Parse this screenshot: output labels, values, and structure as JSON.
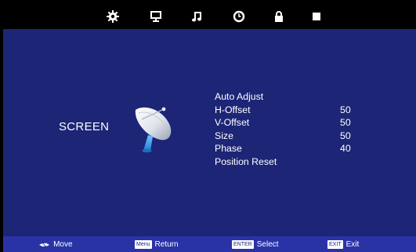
{
  "tabs": [
    {
      "icon": "gear-icon",
      "label": "Picture"
    },
    {
      "icon": "monitor-icon",
      "label": "Screen"
    },
    {
      "icon": "music-icon",
      "label": "Sound"
    },
    {
      "icon": "clock-icon",
      "label": "Time"
    },
    {
      "icon": "lock-icon",
      "label": "Lock"
    },
    {
      "icon": "square-icon",
      "label": "Setup"
    }
  ],
  "category": "SCREEN",
  "menu": {
    "items": [
      {
        "label": "Auto Adjust",
        "value": ""
      },
      {
        "label": "H-Offset",
        "value": "50"
      },
      {
        "label": "V-Offset",
        "value": "50"
      },
      {
        "label": "Size",
        "value": "50"
      },
      {
        "label": "Phase",
        "value": "40"
      },
      {
        "label": "Position Reset",
        "value": ""
      }
    ]
  },
  "footer": {
    "move": {
      "icon": "dpad-icon",
      "label": "Move"
    },
    "return": {
      "key": "Menu",
      "label": "Return"
    },
    "select": {
      "key": "ENTER",
      "label": "Select"
    },
    "exit": {
      "key": "EXIT",
      "label": "Exit"
    }
  },
  "colors": {
    "background": "#1d2576",
    "topbar": "#000000",
    "footer": "#2a33a6",
    "text": "#ffffff"
  }
}
